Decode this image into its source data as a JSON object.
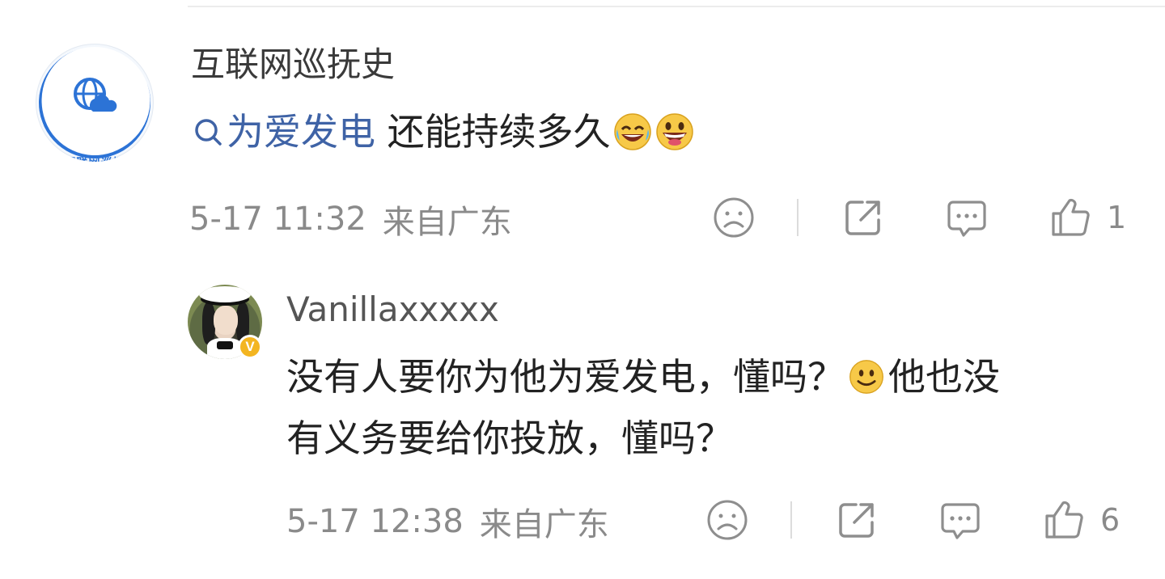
{
  "post": {
    "username": "互联网巡抚史",
    "avatar_logo_text": "互联网巡抚",
    "topic": "为爱发电",
    "text": " 还能持续多久",
    "emojis": [
      "laugh-cry-emoji",
      "grin-emoji"
    ],
    "timestamp": "5-17 11:32",
    "location": "来自广东",
    "like_count": "1"
  },
  "reply": {
    "username": "Vanillaxxxxx",
    "badge": "V",
    "text_line1_a": "没有人要你为他为爱发电，懂吗？",
    "text_line1_b": "他也没",
    "text_line2": "有义务要给你投放，懂吗？",
    "emojis": [
      "smile-emoji"
    ],
    "timestamp": "5-17 12:38",
    "location": "来自广东",
    "like_count": "6"
  },
  "icons": [
    "dislike-face-icon",
    "share-icon",
    "comment-icon",
    "like-thumb-icon",
    "search-icon"
  ],
  "colors": {
    "topic_link": "#3f63a6",
    "meta_gray": "#8a8a8a",
    "logo_blue": "#2c73d6",
    "verified_badge": "#f3b521"
  }
}
